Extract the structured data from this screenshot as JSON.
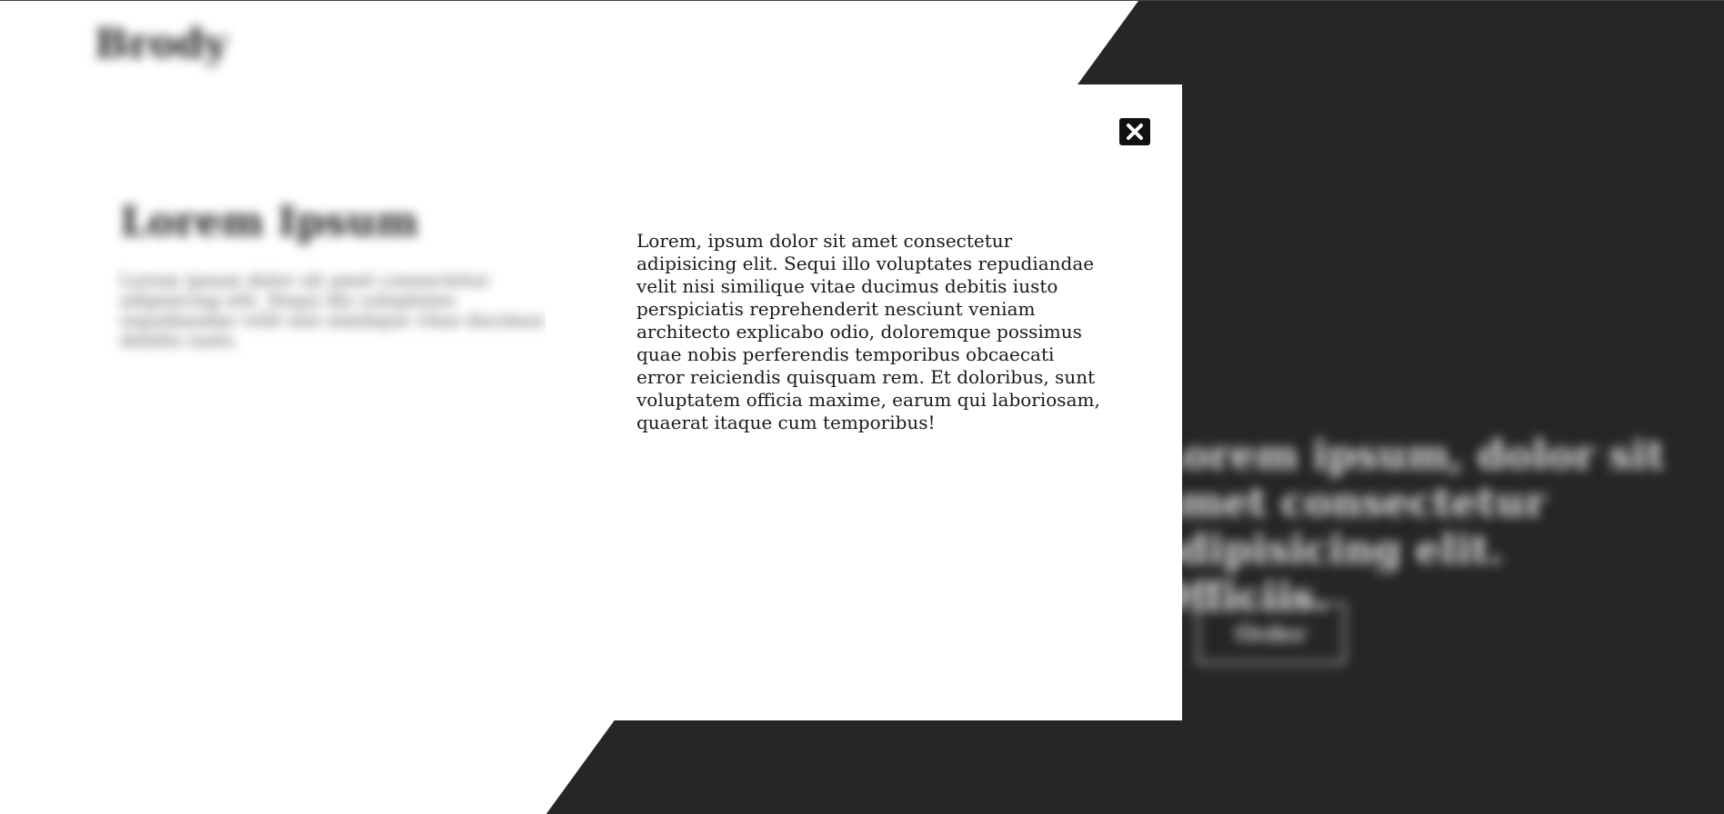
{
  "background": {
    "logo": "Brody",
    "heading": "Lorem Ipsum",
    "paragraph": "Lorem ipsum dolor sit amet consectetur adipisicing elit. Sequi illo voluptates repudiandae velit nisi similique vitae ducimus debitis iusto.",
    "hero_text": "Lorem ipsum, dolor sit amet consectetur adipisicing elit. Officiis.",
    "button_label": "Order",
    "dark_color": "#262626",
    "light_color": "#ffffff"
  },
  "modal": {
    "close_icon": "close-icon",
    "body_text": "Lorem, ipsum dolor sit amet consectetur adipisicing elit. Sequi illo voluptates repudiandae velit nisi similique vitae ducimus debitis iusto perspiciatis reprehenderit nesciunt veniam architecto explicabo odio, doloremque possimus quae nobis perferendis temporibus obcaecati error reiciendis quisquam rem. Et doloribus, sunt voluptatem officia maxime, earum qui laboriosam, quaerat itaque cum temporibus!"
  }
}
